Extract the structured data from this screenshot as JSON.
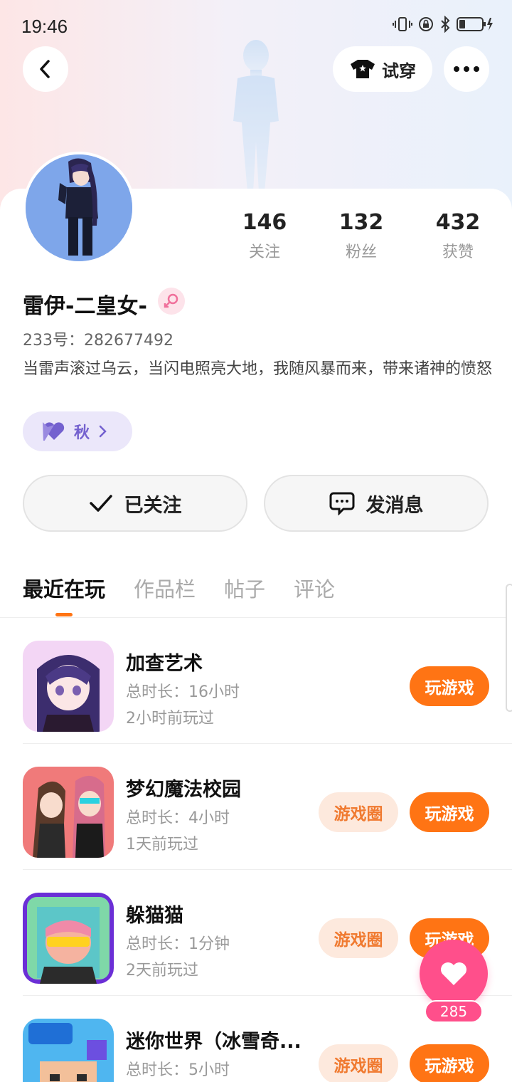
{
  "status_bar": {
    "time": "19:46"
  },
  "header": {
    "try_on_label": "试穿"
  },
  "profile": {
    "stats": [
      {
        "value": "146",
        "label": "关注"
      },
      {
        "value": "132",
        "label": "粉丝"
      },
      {
        "value": "432",
        "label": "获赞"
      }
    ],
    "name": "雷伊-二皇女-",
    "uid": "233号：282677492",
    "bio": "当雷声滚过乌云，当闪电照亮大地，我随风暴而来，带来诸神的愤怒",
    "badge_label": "秋"
  },
  "actions": {
    "follow_label": "已关注",
    "message_label": "发消息"
  },
  "tabs": [
    {
      "label": "最近在玩"
    },
    {
      "label": "作品栏"
    },
    {
      "label": "帖子"
    },
    {
      "label": "评论"
    }
  ],
  "games": [
    {
      "title": "加查艺术",
      "duration": "总时长：16小时",
      "last_played": "2小时前玩过",
      "circle_label": "",
      "play_label": "玩游戏"
    },
    {
      "title": "梦幻魔法校园",
      "duration": "总时长：4小时",
      "last_played": "1天前玩过",
      "circle_label": "游戏圈",
      "play_label": "玩游戏"
    },
    {
      "title": "躲猫猫",
      "duration": "总时长：1分钟",
      "last_played": "2天前玩过",
      "circle_label": "游戏圈",
      "play_label": "玩游戏"
    },
    {
      "title": "迷你世界（冰雪奇...",
      "duration": "总时长：5小时",
      "last_played": "",
      "circle_label": "游戏圈",
      "play_label": "玩游戏"
    }
  ],
  "like_fab": {
    "count": "285"
  },
  "colors": {
    "accent": "#ff7414",
    "pink": "#ff4f8b",
    "purple": "#7461cf"
  }
}
